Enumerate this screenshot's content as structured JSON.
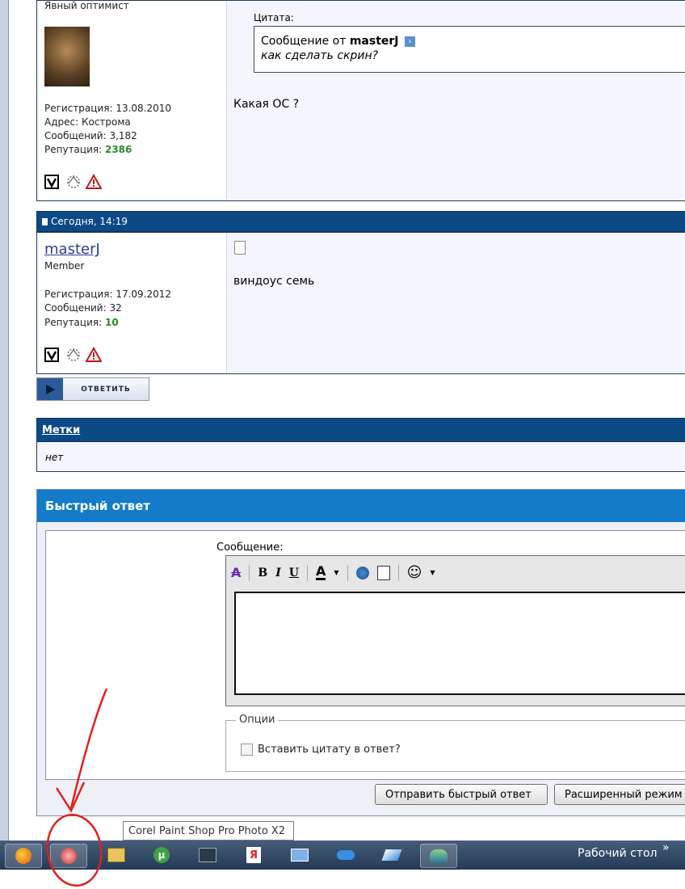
{
  "post1": {
    "user_title": "Явный оптимист",
    "quote_label": "Цитата:",
    "quote_prefix": "Сообщение от",
    "quote_author": "masterJ",
    "quote_text": "как сделать скрин?",
    "message": "Какая ОС ?",
    "reg": "Регистрация: 13.08.2010",
    "address": "Адрес: Кострома",
    "posts": "Сообщений: 3,182",
    "rep_label": "Репутация:",
    "rep_value": "2386"
  },
  "post2": {
    "date": "Сегодня, 14:19",
    "username": "masterJ",
    "user_title": "Member",
    "reg": "Регистрация: 17.09.2012",
    "posts": "Сообщений: 32",
    "rep_label": "Репутация:",
    "rep_value": "10",
    "message": "виндоус семь"
  },
  "reply_button": {
    "label": "ОТВЕТИТЬ"
  },
  "tags": {
    "title": "Метки",
    "value": "нет"
  },
  "quick_reply": {
    "title": "Быстрый ответ",
    "message_label": "Сообщение:",
    "options_legend": "Опции",
    "quote_checkbox": "Вставить цитату в ответ?",
    "send_button": "Отправить быстрый ответ",
    "advanced_button": "Расширенный режим"
  },
  "tooltip": {
    "text": "Corel Paint Shop Pro Photo X2"
  },
  "taskbar": {
    "desktop_label": "Рабочий стол",
    "chevron": "»"
  },
  "colors": {
    "header_blue": "#0c4a86",
    "quick_reply_blue": "#137bc8",
    "annotation_red": "#e02020"
  }
}
